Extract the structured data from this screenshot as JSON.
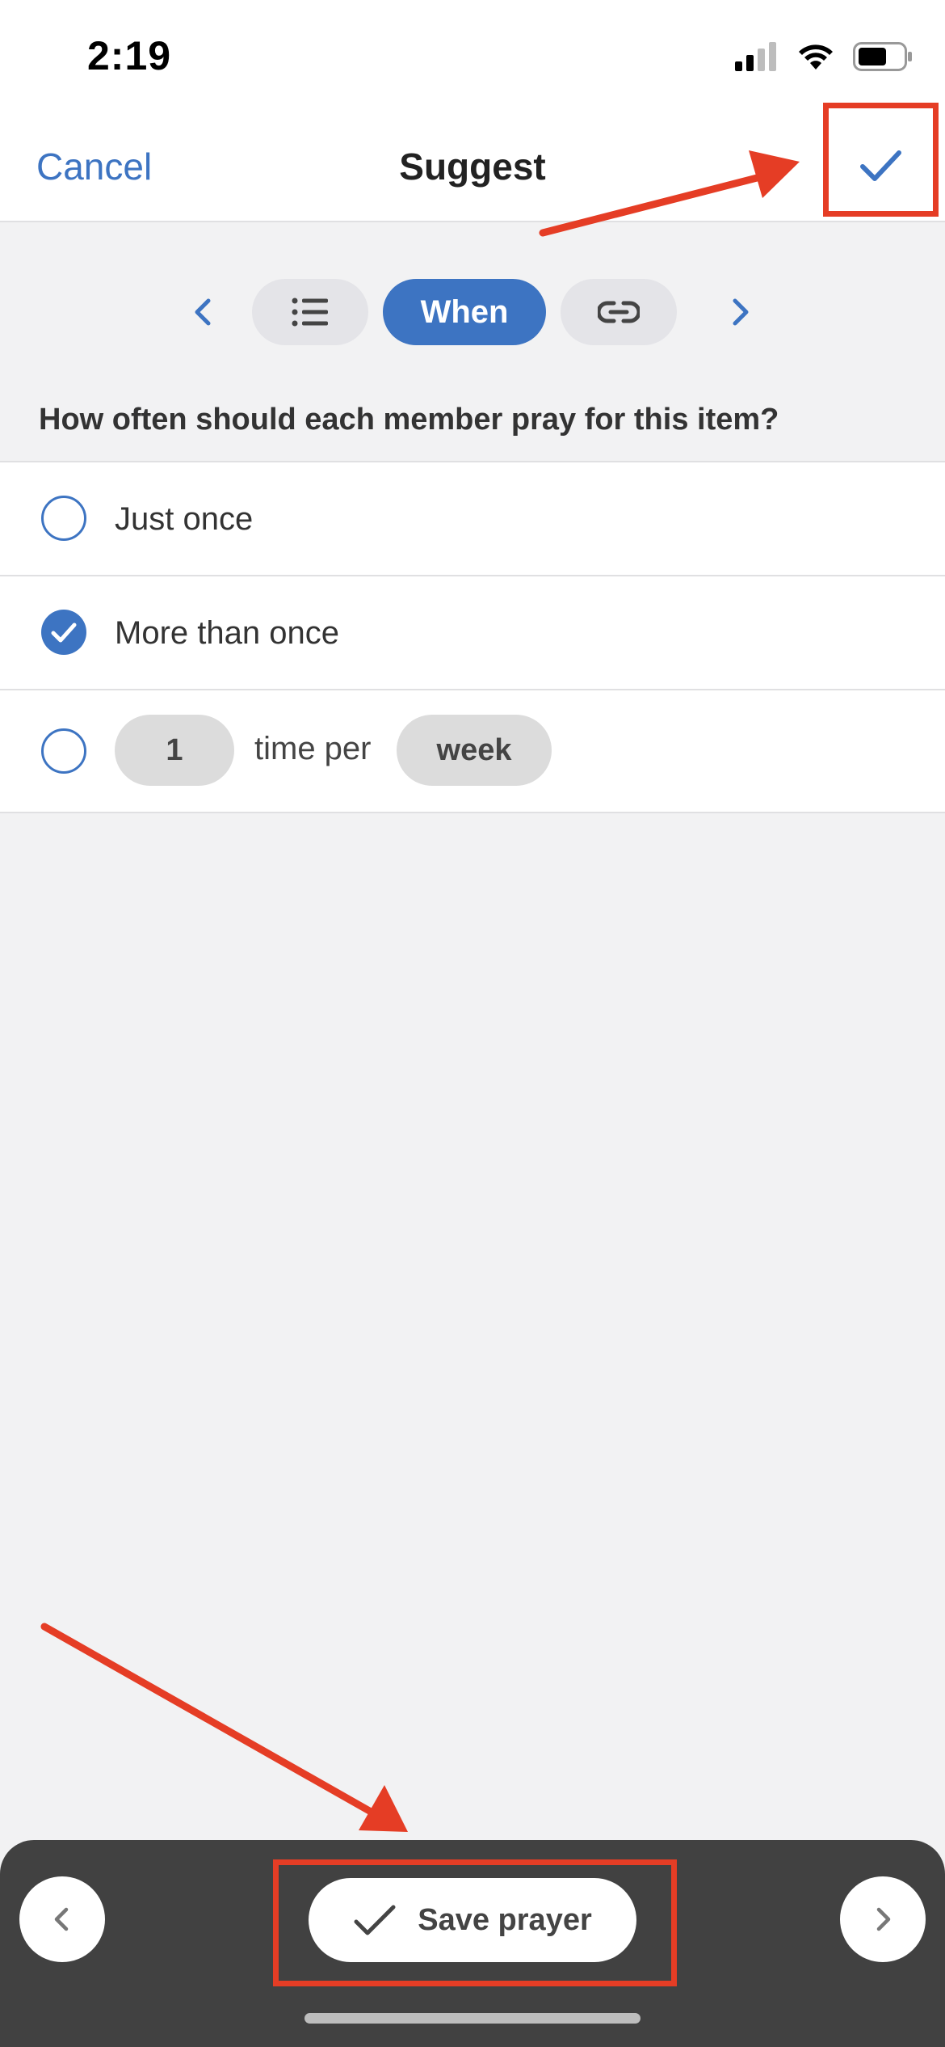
{
  "status_bar": {
    "time": "2:19"
  },
  "nav": {
    "cancel": "Cancel",
    "title": "Suggest"
  },
  "segments": {
    "active_label": "When"
  },
  "question": "How often should each member pray for this item?",
  "options": {
    "just_once": "Just once",
    "more_than_once": "More than once",
    "count": "1",
    "time_per": "time per",
    "unit": "week"
  },
  "bottom": {
    "save_label": "Save prayer"
  },
  "colors": {
    "accent": "#3d74c2",
    "annotation": "#e53d25",
    "bottom_bar": "#414141"
  }
}
